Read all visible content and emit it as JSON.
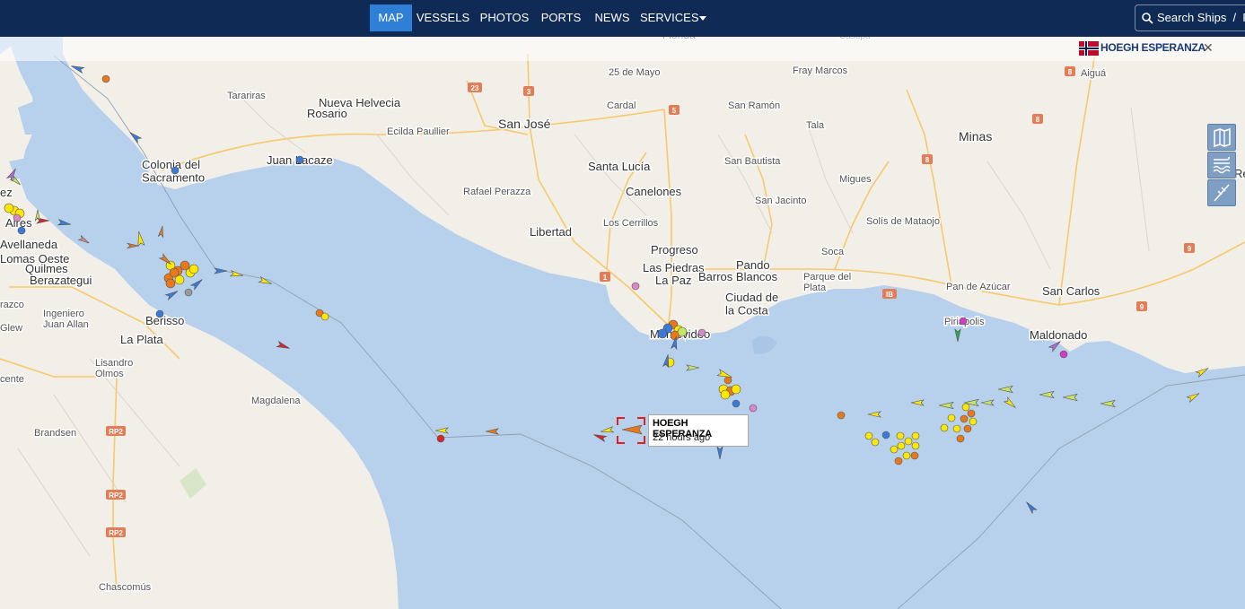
{
  "nav": {
    "items": [
      {
        "label": "MAP",
        "active": true
      },
      {
        "label": "VESSELS"
      },
      {
        "label": "PHOTOS"
      },
      {
        "label": "PORTS"
      },
      {
        "label": "NEWS"
      },
      {
        "label": "SERVICES",
        "has_dropdown": true
      }
    ],
    "search_label": "Search Ships  /  P"
  },
  "selected_vessel": {
    "name": "HOEGH ESPERANZA",
    "flag": "Norway",
    "last_seen": "22 hours ago"
  },
  "map_controls": [
    "map-layers-icon",
    "wind-waves-icon",
    "measure-tool-icon"
  ],
  "places": {
    "florida": "Florida",
    "casupa": "Casupá",
    "veinticinco_mayo": "25 de Mayo",
    "fray_marcos": "Fray Marcos",
    "aigua": "Aiguá",
    "tarariras": "Tarariras",
    "nueva_helvecia": "Nueva Helvecia",
    "rosario": "Rosario",
    "cardal": "Cardal",
    "san_ramon": "San Ramón",
    "ecilda_paullier": "Ecilda Paullier",
    "san_jose": "San José",
    "tala": "Tala",
    "minas": "Minas",
    "colonia": "Colonia del\nSacramento",
    "juan_lacaze": "Juan Lacaze",
    "santa_lucia": "Santa Lucía",
    "san_bautista": "San Bautista",
    "migues": "Migues",
    "rafael_perazza": "Rafael Perazza",
    "canelones": "Canelones",
    "san_jacinto": "San Jacinto",
    "los_cerrillos": "Los Cerrillos",
    "solis_mataojo": "Solís de Mataojo",
    "libertad": "Libertad",
    "progreso": "Progreso",
    "soca": "Soca",
    "pando": "Pando",
    "las_piedras": "Las Piedras",
    "barros_blancos": "Barros Blancos",
    "parque_plata": "Parque del\nPlata",
    "la_paz": "La Paz",
    "pan_azucar": "Pan de Azúcar",
    "san_carlos": "San Carlos",
    "ciudad_costa": "Ciudad de\nla Costa",
    "piriapolis": "Piriápolis",
    "maldonado": "Maldonado",
    "montevideo": "Montevideo",
    "avellaneda": "Avellaneda",
    "lomas_oeste": "Lomas Oeste",
    "quilmes": "Quilmes",
    "berazategui": "Berazategui",
    "ingeniero_allan": "Ingeniero\nJuan Allan",
    "berisso": "Berisso",
    "la_plata": "La Plata",
    "lisandro_olmos": "Lisandro\nOlmos",
    "magdalena": "Magdalena",
    "brandsen": "Brandsen",
    "chascomus": "Chascomús",
    "aires": "Aires",
    "ez": "ez",
    "razco": "razco",
    "glew": "Glew",
    "cente": "cente",
    "re": "Re"
  },
  "road_shields": [
    "23",
    "3",
    "5",
    "8",
    "8",
    "8",
    "9",
    "9",
    "1",
    "IB",
    "RP2",
    "RP2",
    "RP2"
  ],
  "colors": {
    "water": "#b7d0ec",
    "land": "#f2efe9",
    "nav_bg": "#0f2a55",
    "nav_active": "#2f7fd6",
    "tanker": "#e8791b",
    "cargo": "#c8e664",
    "passenger": "#3b7bd8",
    "fishing": "#ffe800",
    "highlight": "#e02020"
  }
}
